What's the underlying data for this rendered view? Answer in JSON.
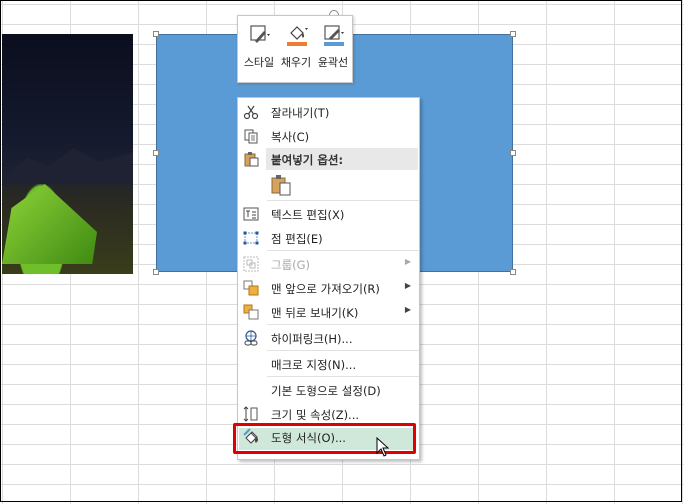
{
  "mini_toolbar": {
    "style_label": "스타일",
    "fill_label": "채우기",
    "outline_label": "윤곽선",
    "fill_color": "#ed7d31",
    "outline_color": "#5b9bd5"
  },
  "shape": {
    "fill_color": "#5b9bd5"
  },
  "context_menu": {
    "cut": "잘라내기(T)",
    "copy": "복사(C)",
    "paste_options": "붙여넣기 옵션:",
    "edit_text": "텍스트 편집(X)",
    "edit_points": "점 편집(E)",
    "group": "그룹(G)",
    "bring_to_front": "맨 앞으로 가져오기(R)",
    "send_to_back": "맨 뒤로 보내기(K)",
    "hyperlink": "하이퍼링크(H)...",
    "assign_macro": "매크로 지정(N)...",
    "set_default_shape": "기본 도형으로 설정(D)",
    "size_properties": "크기 및 속성(Z)...",
    "format_shape": "도형 서식(O)..."
  },
  "highlight_color": "#e00000"
}
